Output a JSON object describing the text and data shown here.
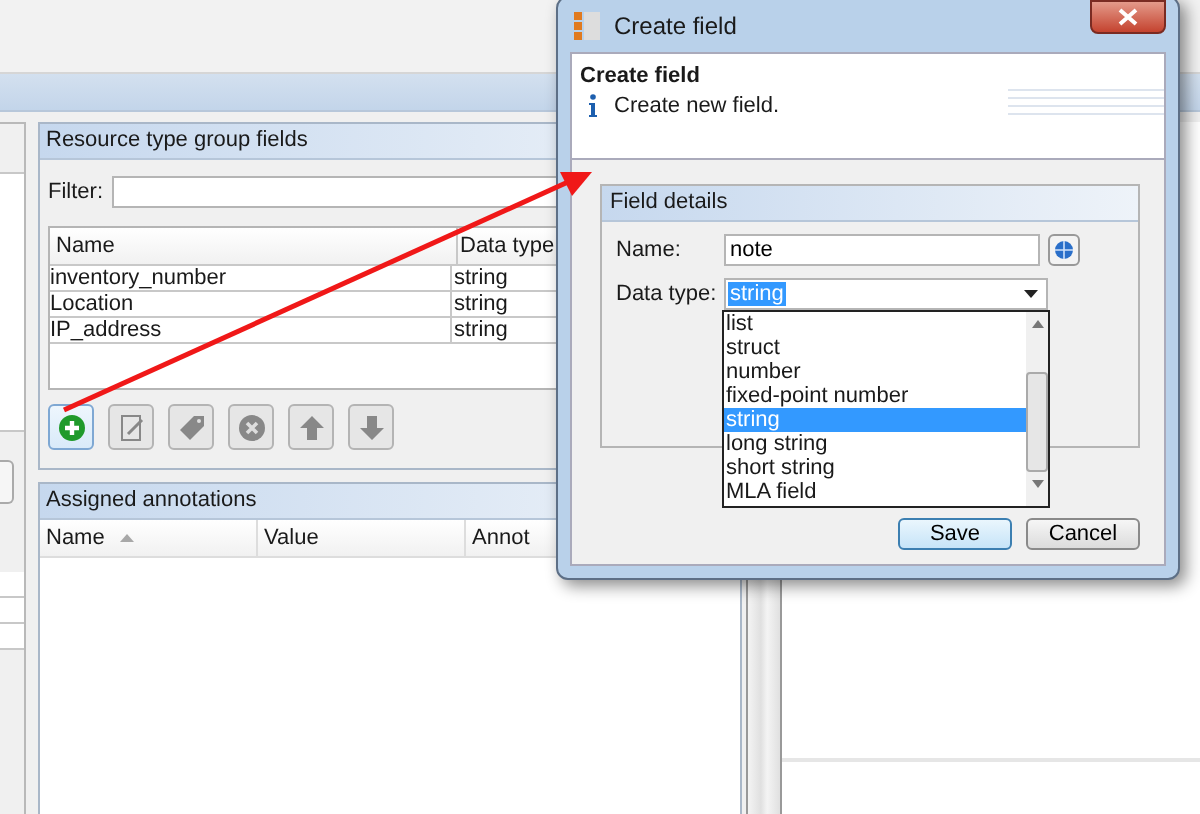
{
  "main_window": {
    "fields_panel": {
      "title": "Resource type group fields",
      "filter_label": "Filter:",
      "table": {
        "columns": [
          "Name",
          "Data type"
        ],
        "rows": [
          [
            "inventory_number",
            "string"
          ],
          [
            "Location",
            "string"
          ],
          [
            "IP_address",
            "string"
          ]
        ]
      },
      "toolbar": [
        {
          "kind": "add",
          "disabled": false
        },
        {
          "kind": "edit",
          "disabled": true
        },
        {
          "kind": "tag",
          "disabled": true
        },
        {
          "kind": "delete",
          "disabled": true
        },
        {
          "kind": "up",
          "disabled": true
        },
        {
          "kind": "down",
          "disabled": true
        }
      ]
    },
    "annotations_panel": {
      "title": "Assigned annotations",
      "columns": [
        {
          "label": "Name",
          "sorted": true
        },
        {
          "label": "Value",
          "sorted": false
        },
        {
          "label": "Annot",
          "sorted": false
        }
      ]
    }
  },
  "dialog": {
    "title": "Create field",
    "heading": "Create field",
    "info": "Create new field.",
    "group_title": "Field details",
    "name_label": "Name:",
    "name_value": "note",
    "type_label": "Data type:",
    "type_value": "string",
    "type_options": [
      {
        "label": "list",
        "selected": false
      },
      {
        "label": "struct",
        "selected": false
      },
      {
        "label": "number",
        "selected": false
      },
      {
        "label": "fixed-point number",
        "selected": false
      },
      {
        "label": "string",
        "selected": true
      },
      {
        "label": "long string",
        "selected": false
      },
      {
        "label": "short string",
        "selected": false
      },
      {
        "label": "MLA field",
        "selected": false
      }
    ],
    "buttons": [
      {
        "label": "Save",
        "default": true
      },
      {
        "label": "Cancel",
        "default": false
      }
    ]
  }
}
